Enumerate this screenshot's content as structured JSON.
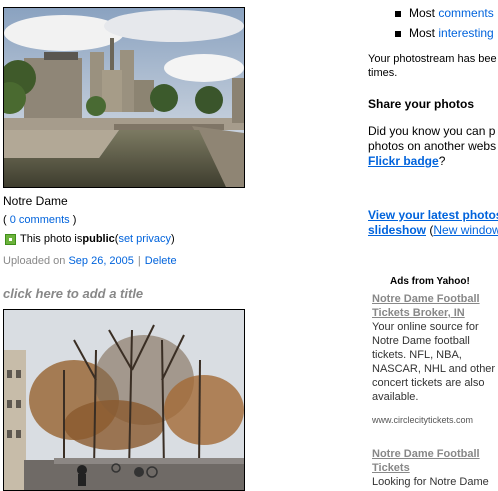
{
  "right_list": {
    "items": [
      {
        "prefix": "Most",
        "link": "comments"
      },
      {
        "prefix": "Most",
        "link": "interesting"
      }
    ]
  },
  "photostream": {
    "text_line1": "Your photostream has bee",
    "text_line2": "times."
  },
  "share": {
    "heading": "Share your photos",
    "line1": "Did you know you can p",
    "line2": "photos on another webs",
    "badge_link": "Flickr badge",
    "badge_suffix": "?"
  },
  "slideshow": {
    "link1": "View your latest photos",
    "link1b": "slideshow",
    "paren_open": " (",
    "link2": "New window"
  },
  "photo1": {
    "title": "Notre Dame",
    "comments_open": "( ",
    "comments_link": "0 comments",
    "comments_close": " )",
    "privacy_prefix": "This photo is ",
    "privacy_status": "public",
    "privacy_open": " ( ",
    "privacy_link": "set privacy",
    "privacy_close": " )",
    "uploaded_label": "Uploaded on ",
    "uploaded_date": "Sep 26, 2005",
    "separator": "|",
    "delete": "Delete"
  },
  "photo2": {
    "add_title": "click here to add a title"
  },
  "ads": {
    "heading": "Ads from Yahoo!",
    "items": [
      {
        "title_line1": "Notre Dame Football",
        "title_line2": "Tickets Broker, IN",
        "body": [
          "Your online source for",
          "Notre Dame football",
          "tickets. NFL, NBA,",
          "NASCAR, NHL and other",
          "concert tickets are also",
          "available."
        ],
        "url": "www.circlecitytickets.com"
      },
      {
        "title_line1": "Notre Dame Football",
        "title_line2": "Tickets",
        "body": [
          "Looking for Notre Dame"
        ]
      }
    ]
  },
  "colors": {
    "link": "#0063DC",
    "muted": "#888888",
    "public_icon": "#6cb23c"
  }
}
